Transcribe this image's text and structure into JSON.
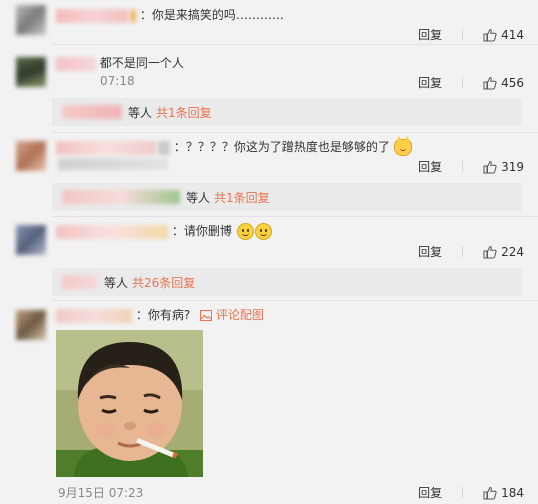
{
  "comments": [
    {
      "text": "：你是来搞笑的吗…………",
      "reply_label": "回复",
      "likes": "414"
    },
    {
      "text": "都不是同一个人",
      "time": "07:18",
      "reply_label": "回复",
      "likes": "456",
      "sub": {
        "label": "等人",
        "link": "共1条回复"
      }
    },
    {
      "text": "：？？？？你这为了蹭热度也是够够的了",
      "reply_label": "回复",
      "likes": "319",
      "sub": {
        "label": "等人",
        "link": "共1条回复"
      }
    },
    {
      "text": "：请你删博",
      "reply_label": "回复",
      "likes": "224",
      "sub": {
        "label": "等人",
        "link": "共26条回复"
      }
    },
    {
      "text": "：你有病?",
      "image_link": "评论配图",
      "time": "9月15日 07:23",
      "reply_label": "回复",
      "likes": "184"
    }
  ],
  "colors": {
    "link": "#eb7350",
    "background": "#f2f2f2",
    "sub_background": "#eaeaea"
  },
  "icons": {
    "like": "thumbs-up-icon",
    "image": "image-icon"
  }
}
